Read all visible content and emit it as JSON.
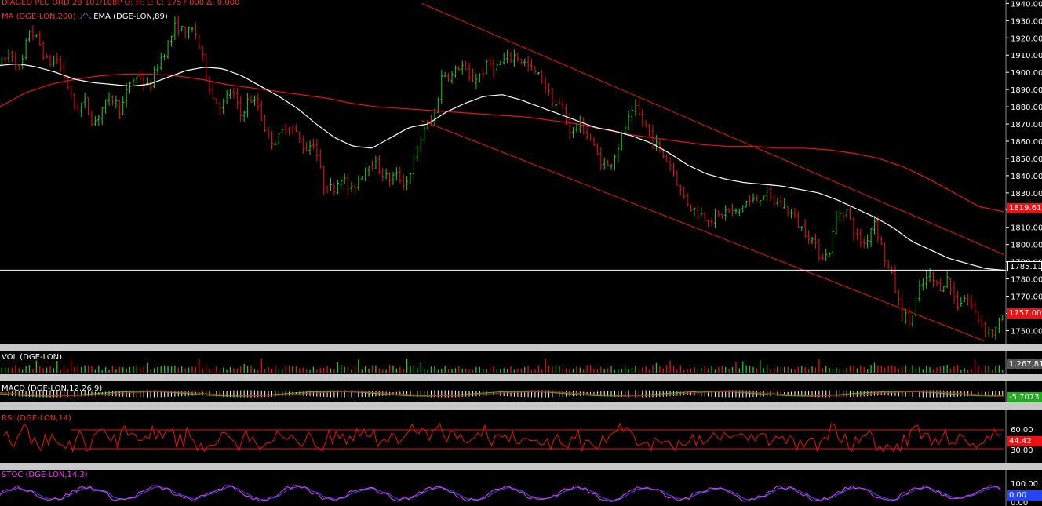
{
  "header": {
    "symbol_line": "DIAGEO PLC ORD 28 101/108P  O:    H:    L:    C: 1757.000   Δ: 0.000",
    "ma_label": "MA (DGE-LON,200)",
    "ema_label": "EMA (DGE-LON,89)"
  },
  "tags": {
    "ma_value": "1819.610",
    "hline_value": "1785.114",
    "last_price": "1757.000",
    "volume_value": "1,267,81",
    "macd_value": "-5.7073",
    "rsi_value": "44.42",
    "stoc_value": "0.00"
  },
  "panels": {
    "vol_label": "VOL (DGE-LON)",
    "macd_label": "MACD (DGE-LON,12,26,9)",
    "rsi_label": "RSI (DGE-LON,14)",
    "stoc_label": "STOC (DGE-LON,14,3)"
  },
  "colors": {
    "up": "#22cc22",
    "down": "#ee1111",
    "ma": "#ee1111",
    "ema": "#ffffff",
    "macd_hist": "#ffffff",
    "rsi": "#ee1111",
    "stoc_k": "#ff33ff",
    "stoc_d": "#3355ff"
  },
  "chart_data": {
    "type": "candlestick",
    "ylim": [
      1742,
      1942
    ],
    "y_ticks": [
      "1940.000",
      "1930.000",
      "1920.000",
      "1910.000",
      "1900.000",
      "1890.000",
      "1880.000",
      "1870.000",
      "1860.000",
      "1850.000",
      "1840.000",
      "1830.000",
      "1820.000",
      "1810.000",
      "1800.000",
      "1790.000",
      "1780.000",
      "1770.000",
      "1760.000",
      "1750.000"
    ],
    "close_path": [
      1905,
      1912,
      1900,
      1925,
      1918,
      1905,
      1908,
      1895,
      1878,
      1883,
      1870,
      1880,
      1885,
      1878,
      1895,
      1898,
      1890,
      1905,
      1915,
      1928,
      1922,
      1925,
      1905,
      1885,
      1880,
      1890,
      1875,
      1885,
      1880,
      1862,
      1860,
      1870,
      1865,
      1855,
      1860,
      1835,
      1832,
      1840,
      1830,
      1840,
      1848,
      1845,
      1838,
      1840,
      1835,
      1850,
      1868,
      1872,
      1900,
      1898,
      1905,
      1895,
      1898,
      1905,
      1903,
      1908,
      1910,
      1905,
      1900,
      1895,
      1882,
      1880,
      1865,
      1870,
      1862,
      1850,
      1845,
      1855,
      1870,
      1878,
      1870,
      1860,
      1852,
      1845,
      1830,
      1822,
      1818,
      1815,
      1816,
      1820,
      1818,
      1825,
      1825,
      1830,
      1825,
      1823,
      1818,
      1810,
      1805,
      1795,
      1793,
      1818,
      1820,
      1805,
      1800,
      1815,
      1795,
      1780,
      1760,
      1755,
      1775,
      1782,
      1775,
      1780,
      1765,
      1770,
      1760,
      1752,
      1748,
      1757
    ],
    "ema_path": [
      1904,
      1905,
      1903,
      1900,
      1896,
      1894,
      1893,
      1892,
      1893,
      1897,
      1901,
      1903,
      1902,
      1898,
      1892,
      1886,
      1879,
      1870,
      1862,
      1857,
      1856,
      1862,
      1868,
      1870,
      1877,
      1882,
      1886,
      1887,
      1884,
      1880,
      1876,
      1872,
      1868,
      1866,
      1863,
      1859,
      1853,
      1846,
      1841,
      1838,
      1836,
      1835,
      1834,
      1832,
      1830,
      1826,
      1821,
      1816,
      1810,
      1802,
      1797,
      1792,
      1789,
      1786,
      1785
    ],
    "ma_path": [
      1880,
      1888,
      1893,
      1896,
      1898,
      1899,
      1899,
      1898,
      1896,
      1893,
      1891,
      1889,
      1887,
      1885,
      1882,
      1880,
      1879,
      1878,
      1877,
      1876,
      1875,
      1874,
      1872,
      1870,
      1867,
      1864,
      1862,
      1860,
      1858,
      1857,
      1857,
      1856,
      1856,
      1855,
      1853,
      1850,
      1845,
      1838,
      1830,
      1822,
      1819
    ],
    "channel_upper": [
      [
        0.42,
        1940
      ],
      [
        1.0,
        1794
      ]
    ],
    "channel_lower": [
      [
        0.42,
        1872
      ],
      [
        0.98,
        1744
      ]
    ],
    "hline": 1785.114,
    "rsi_levels": [
      60,
      30
    ],
    "stoc_levels": [
      100,
      0
    ]
  }
}
